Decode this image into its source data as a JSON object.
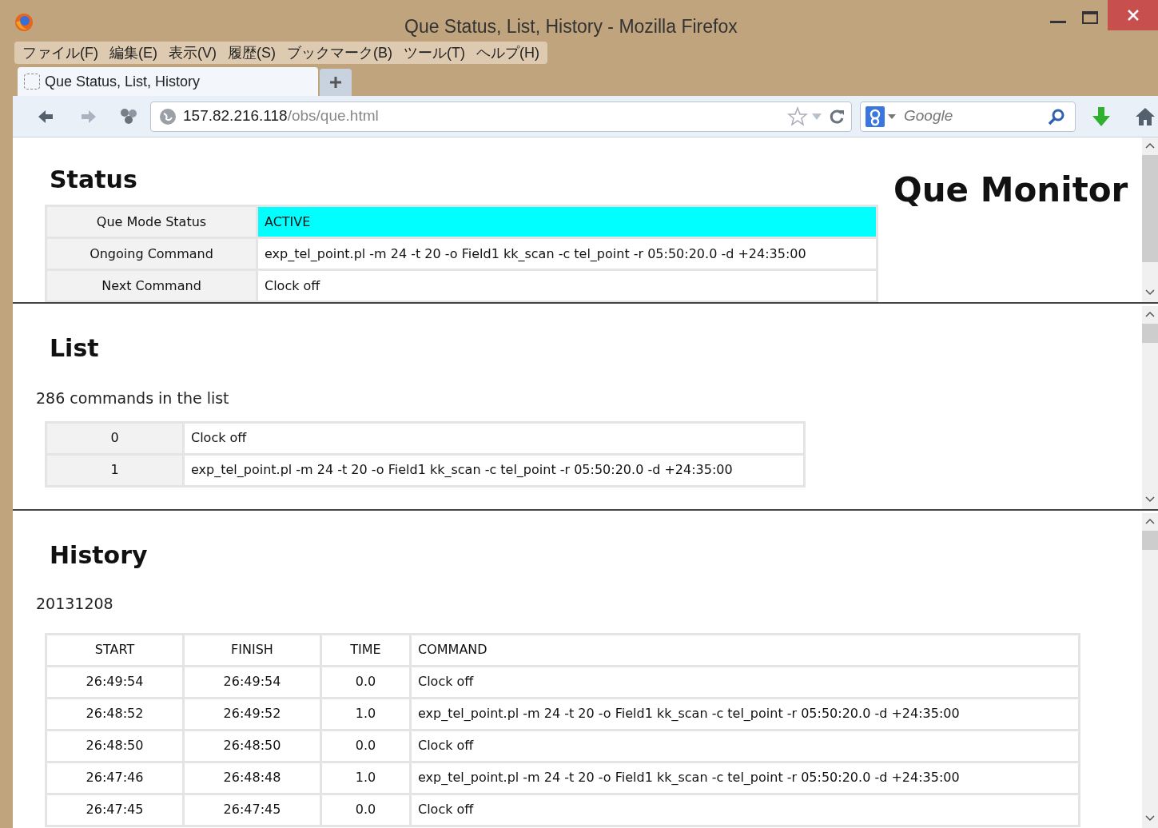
{
  "window": {
    "title": "Que Status, List, History - Mozilla Firefox"
  },
  "menu": [
    "ファイル(F)",
    "編集(E)",
    "表示(V)",
    "履歴(S)",
    "ブックマーク(B)",
    "ツール(T)",
    "ヘルプ(H)"
  ],
  "tabs": [
    {
      "label": "Que Status, List, History",
      "selected": true
    }
  ],
  "address": {
    "host": "157.82.216.118",
    "path": "/obs/que.html"
  },
  "search": {
    "placeholder": "Google"
  },
  "status": {
    "heading": "Status",
    "side_title": "Que Monitor",
    "rows": [
      {
        "label": "Que Mode Status",
        "value": "ACTIVE",
        "color": "#00ffff"
      },
      {
        "label": "Ongoing Command",
        "value": "exp_tel_point.pl -m 24 -t 20 -o Field1 kk_scan -c tel_point -r 05:50:20.0 -d +24:35:00"
      },
      {
        "label": "Next Command",
        "value": "Clock off"
      }
    ]
  },
  "list": {
    "heading": "List",
    "summary": "286 commands in the list",
    "rows": [
      {
        "index": "0",
        "command": "Clock off"
      },
      {
        "index": "1",
        "command": "exp_tel_point.pl -m 24 -t 20 -o Field1 kk_scan -c tel_point -r 05:50:20.0 -d +24:35:00"
      }
    ]
  },
  "history": {
    "heading": "History",
    "date": "20131208",
    "columns": [
      "START",
      "FINISH",
      "TIME",
      "COMMAND"
    ],
    "rows": [
      [
        "26:49:54",
        "26:49:54",
        "0.0",
        "Clock off"
      ],
      [
        "26:48:52",
        "26:49:52",
        "1.0",
        "exp_tel_point.pl -m 24 -t 20 -o Field1 kk_scan -c tel_point -r 05:50:20.0 -d +24:35:00"
      ],
      [
        "26:48:50",
        "26:48:50",
        "0.0",
        "Clock off"
      ],
      [
        "26:47:46",
        "26:48:48",
        "1.0",
        "exp_tel_point.pl -m 24 -t 20 -o Field1 kk_scan -c tel_point -r 05:50:20.0 -d +24:35:00"
      ],
      [
        "26:47:45",
        "26:47:45",
        "0.0",
        "Clock off"
      ]
    ]
  }
}
